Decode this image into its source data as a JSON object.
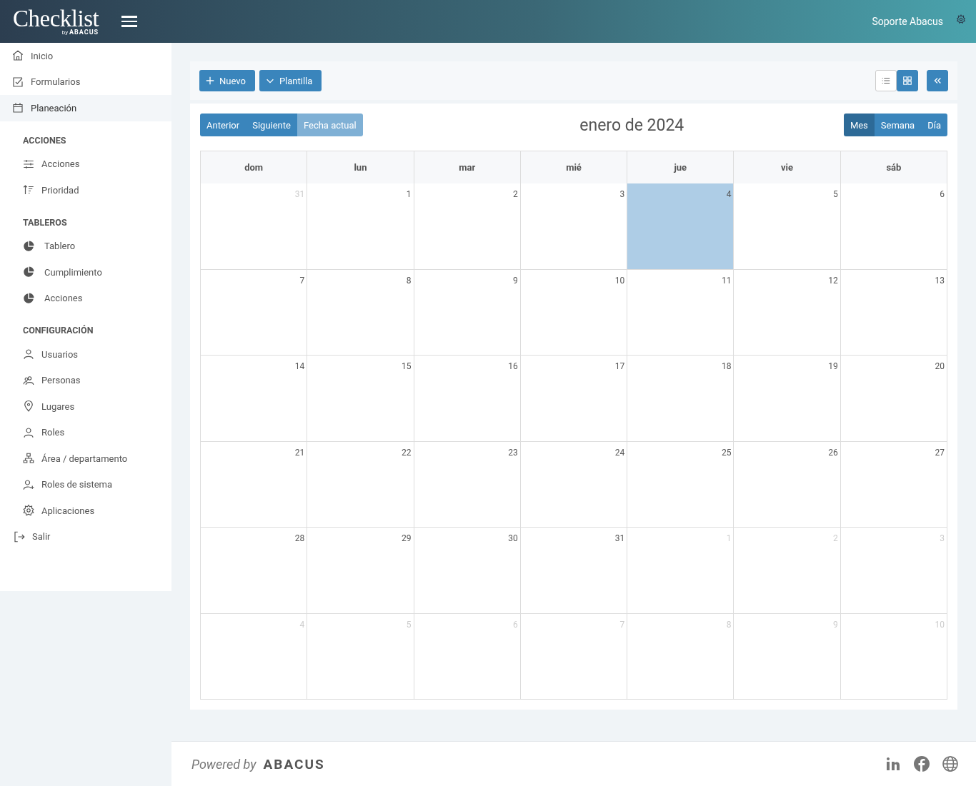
{
  "header": {
    "logo": "Checklist",
    "logo_by": "by",
    "logo_brand": "ABACUS",
    "user": "Soporte Abacus"
  },
  "sidebar": {
    "items": [
      {
        "label": "Inicio",
        "selected": false
      },
      {
        "label": "Formularios",
        "selected": false
      },
      {
        "label": "Planeación",
        "selected": true
      }
    ],
    "sections": [
      {
        "title": "ACCIONES",
        "items": [
          {
            "label": "Acciones"
          },
          {
            "label": "Prioridad"
          }
        ]
      },
      {
        "title": "TABLEROS",
        "items": [
          {
            "label": "Tablero"
          },
          {
            "label": "Cumplimiento"
          },
          {
            "label": "Acciones"
          }
        ]
      },
      {
        "title": "CONFIGURACIÓN",
        "items": [
          {
            "label": "Usuarios"
          },
          {
            "label": "Personas"
          },
          {
            "label": "Lugares"
          },
          {
            "label": "Roles"
          },
          {
            "label": "Área / departamento"
          },
          {
            "label": "Roles de sistema"
          },
          {
            "label": "Aplicaciones"
          }
        ]
      }
    ],
    "logout": "Salir"
  },
  "toolbar": {
    "buttons": [
      "Nuevo",
      "Plantilla"
    ],
    "views": [
      {
        "kind": "list",
        "selected": false
      },
      {
        "kind": "grid",
        "selected": true
      }
    ]
  },
  "calendar": {
    "title": "enero de 2024",
    "nav": [
      {
        "label": "Anterior",
        "disabled": false
      },
      {
        "label": "Siguiente",
        "disabled": false
      },
      {
        "label": "Fecha actual",
        "disabled": true
      }
    ],
    "views": [
      {
        "label": "Mes",
        "selected": true
      },
      {
        "label": "Semana",
        "selected": false
      },
      {
        "label": "Día",
        "selected": false
      }
    ],
    "weekdays": [
      "dom",
      "lun",
      "mar",
      "mié",
      "jue",
      "vie",
      "sáb"
    ],
    "weeks": [
      [
        {
          "day": "31",
          "outside": true,
          "today": false
        },
        {
          "day": "1",
          "outside": false,
          "today": false
        },
        {
          "day": "2",
          "outside": false,
          "today": false
        },
        {
          "day": "3",
          "outside": false,
          "today": false
        },
        {
          "day": "4",
          "outside": false,
          "today": true
        },
        {
          "day": "5",
          "outside": false,
          "today": false
        },
        {
          "day": "6",
          "outside": false,
          "today": false
        }
      ],
      [
        {
          "day": "7",
          "outside": false,
          "today": false
        },
        {
          "day": "8",
          "outside": false,
          "today": false
        },
        {
          "day": "9",
          "outside": false,
          "today": false
        },
        {
          "day": "10",
          "outside": false,
          "today": false
        },
        {
          "day": "11",
          "outside": false,
          "today": false
        },
        {
          "day": "12",
          "outside": false,
          "today": false
        },
        {
          "day": "13",
          "outside": false,
          "today": false
        }
      ],
      [
        {
          "day": "14",
          "outside": false,
          "today": false
        },
        {
          "day": "15",
          "outside": false,
          "today": false
        },
        {
          "day": "16",
          "outside": false,
          "today": false
        },
        {
          "day": "17",
          "outside": false,
          "today": false
        },
        {
          "day": "18",
          "outside": false,
          "today": false
        },
        {
          "day": "19",
          "outside": false,
          "today": false
        },
        {
          "day": "20",
          "outside": false,
          "today": false
        }
      ],
      [
        {
          "day": "21",
          "outside": false,
          "today": false
        },
        {
          "day": "22",
          "outside": false,
          "today": false
        },
        {
          "day": "23",
          "outside": false,
          "today": false
        },
        {
          "day": "24",
          "outside": false,
          "today": false
        },
        {
          "day": "25",
          "outside": false,
          "today": false
        },
        {
          "day": "26",
          "outside": false,
          "today": false
        },
        {
          "day": "27",
          "outside": false,
          "today": false
        }
      ],
      [
        {
          "day": "28",
          "outside": false,
          "today": false
        },
        {
          "day": "29",
          "outside": false,
          "today": false
        },
        {
          "day": "30",
          "outside": false,
          "today": false
        },
        {
          "day": "31",
          "outside": false,
          "today": false
        },
        {
          "day": "1",
          "outside": true,
          "today": false
        },
        {
          "day": "2",
          "outside": true,
          "today": false
        },
        {
          "day": "3",
          "outside": true,
          "today": false
        }
      ],
      [
        {
          "day": "4",
          "outside": true,
          "today": false
        },
        {
          "day": "5",
          "outside": true,
          "today": false
        },
        {
          "day": "6",
          "outside": true,
          "today": false
        },
        {
          "day": "7",
          "outside": true,
          "today": false
        },
        {
          "day": "8",
          "outside": true,
          "today": false
        },
        {
          "day": "9",
          "outside": true,
          "today": false
        },
        {
          "day": "10",
          "outside": true,
          "today": false
        }
      ]
    ]
  },
  "footer": {
    "powered": "Powered by",
    "brand": "ABACUS"
  }
}
